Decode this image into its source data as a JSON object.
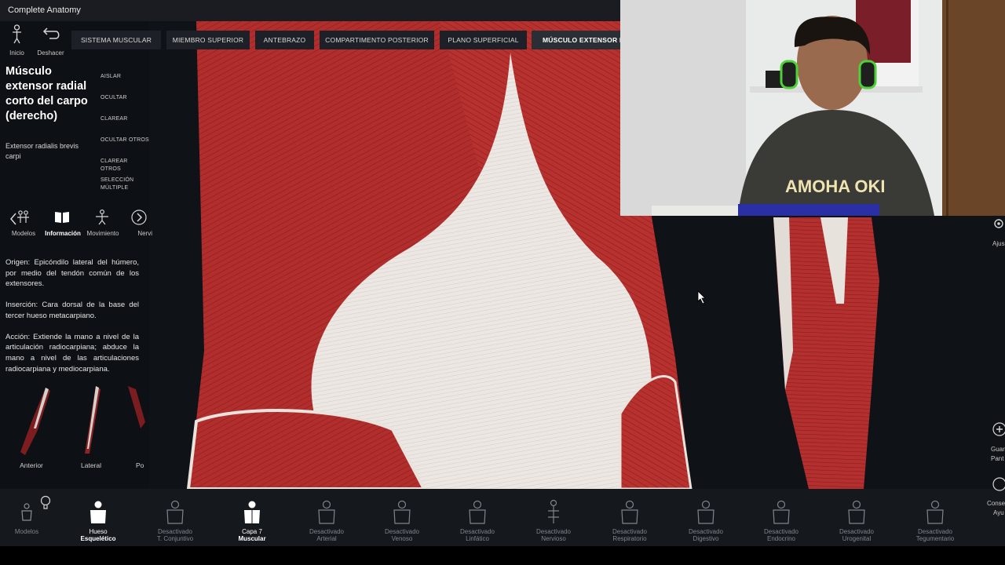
{
  "window": {
    "title": "Complete Anatomy"
  },
  "toolbar": {
    "home_label": "Inicio",
    "undo_label": "Deshacer"
  },
  "breadcrumbs": [
    "SISTEMA MUSCULAR",
    "MIEMBRO SUPERIOR",
    "ANTEBRAZO",
    "COMPARTIMENTO POSTERIOR",
    "PLANO SUPERFICIAL",
    "MÚSCULO EXTENSOR RA"
  ],
  "structure": {
    "title": "Músculo extensor radial corto del carpo (derecho)",
    "latin": "Extensor radialis brevis carpi"
  },
  "actions": [
    "AISLAR",
    "OCULTAR",
    "CLAREAR",
    "OCULTAR OTROS",
    "CLAREAR OTROS",
    "SELECCIÓN",
    "MÚLTIPLE"
  ],
  "tabs": [
    "Modelos",
    "Información",
    "Movimiento",
    "Nervi"
  ],
  "description": [
    "Origen: Epicóndilo lateral del húmero, por medio del tendón común de los extensores.",
    "Inserción: Cara dorsal de la base del tercer hueso metacarpiano.",
    "Acción: Extiende la mano a nivel de la articulación radiocarpiana; abduce la mano a nivel de las articulaciones radiocarpiana y mediocarpiana."
  ],
  "views": [
    "Anterior",
    "Lateral",
    "Po"
  ],
  "systems": [
    {
      "top": "Modelos",
      "bottom": "",
      "active": false
    },
    {
      "top": "Hueso",
      "bottom": "Esquelético",
      "active": true
    },
    {
      "top": "Desactivado",
      "bottom": "T. Conjuntivo",
      "active": false
    },
    {
      "top": "Capa 7",
      "bottom": "Muscular",
      "active": true
    },
    {
      "top": "Desactivado",
      "bottom": "Arterial",
      "active": false
    },
    {
      "top": "Desactivado",
      "bottom": "Venoso",
      "active": false
    },
    {
      "top": "Desactivado",
      "bottom": "Linfático",
      "active": false
    },
    {
      "top": "Desactivado",
      "bottom": "Nervioso",
      "active": false
    },
    {
      "top": "Desactivado",
      "bottom": "Respiratorio",
      "active": false
    },
    {
      "top": "Desactivado",
      "bottom": "Digestivo",
      "active": false
    },
    {
      "top": "Desactivado",
      "bottom": "Endocrino",
      "active": false
    },
    {
      "top": "Desactivado",
      "bottom": "Urogenital",
      "active": false
    },
    {
      "top": "Desactivado",
      "bottom": "Tegumentario",
      "active": false
    }
  ],
  "right_controls": {
    "settings": "Ajus",
    "save_1": "Guar",
    "save_2": "Pant",
    "help_1": "Conse",
    "help_2": "Ayu"
  },
  "webcam_shirt_text": "AMOHA OKI",
  "colors": {
    "muscle": "#b3302f",
    "tendon": "#eae5e1",
    "panel": "#0d1014",
    "bar": "#15181d"
  }
}
